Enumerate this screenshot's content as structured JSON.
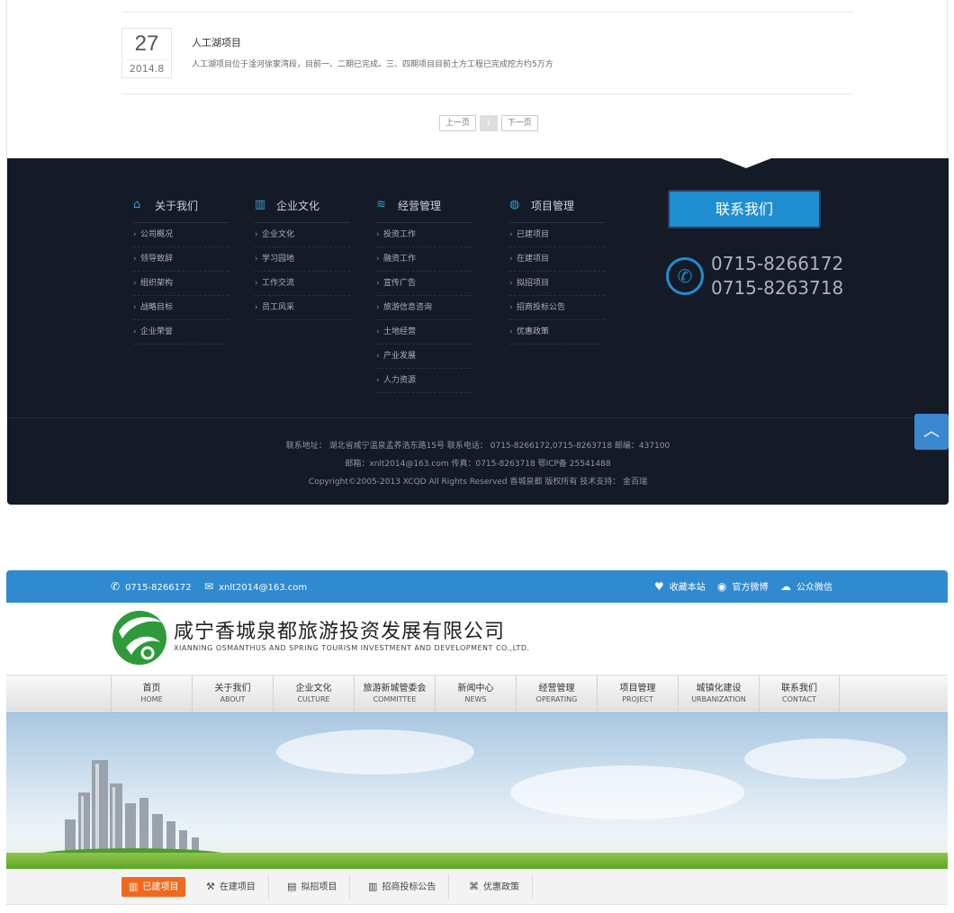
{
  "news": {
    "day": "27",
    "ym": "2014.8",
    "title": "人工湖项目",
    "desc": "人工湖项目位于淦河徐家湾段，目前一、二期已完成。三、四期项目目前土方工程已完成挖方约5万方"
  },
  "pager": {
    "prev": "上一页",
    "current": "1",
    "next": "下一页"
  },
  "footer": {
    "columns": [
      {
        "title": "关于我们",
        "icon": "home-icon",
        "items": [
          "公司概况",
          "领导致辞",
          "组织架构",
          "战略目标",
          "企业荣誉"
        ]
      },
      {
        "title": "企业文化",
        "icon": "building-icon",
        "items": [
          "企业文化",
          "学习园地",
          "工作交流",
          "员工风采"
        ]
      },
      {
        "title": "经营管理",
        "icon": "layers-icon",
        "items": [
          "投资工作",
          "融资工作",
          "宣传广告",
          "旅游信息咨询",
          "土地经营",
          "产业发展",
          "人力资源"
        ]
      },
      {
        "title": "项目管理",
        "icon": "globe-icon",
        "items": [
          "已建项目",
          "在建项目",
          "拟招项目",
          "招商投标公告",
          "优惠政策"
        ]
      }
    ],
    "contact_label": "联系我们",
    "phone1": "0715-8266172",
    "phone2": "0715-8263718",
    "info_line1": "联系地址： 湖北省咸宁温泉孟养浩东路15号   联系电话： 0715-8266172,0715-8263718   邮编：437100",
    "info_line2": "邮箱：xnlt2014@163.com   传真：0715-8263718   鄂ICP备 25541488",
    "info_line3": "Copyright©2005-2013 XCQD All Rights Reserved 香城泉都 版权所有  技术支持： 金百瑞"
  },
  "topbar": {
    "phone": "0715-8266172",
    "email": "xnlt2014@163.com",
    "favorite": "收藏本站",
    "weibo": "官方微博",
    "wechat": "公众微信"
  },
  "logo": {
    "cn": "咸宁香城泉都旅游投资发展有限公司",
    "en": "XIANNING OSMANTHUS AND SPRING TOURISM INVESTMENT AND DEVELOPMENT CO.,LTD."
  },
  "nav": [
    {
      "cn": "首页",
      "en": "HOME"
    },
    {
      "cn": "关于我们",
      "en": "ABOUT"
    },
    {
      "cn": "企业文化",
      "en": "CULTURE"
    },
    {
      "cn": "旅游新城管委会",
      "en": "COMMITTEE"
    },
    {
      "cn": "新闻中心",
      "en": "NEWS"
    },
    {
      "cn": "经营管理",
      "en": "OPERATING"
    },
    {
      "cn": "项目管理",
      "en": "PROJECT"
    },
    {
      "cn": "城镇化建设",
      "en": "URBANIZATION"
    },
    {
      "cn": "联系我们",
      "en": "CONTACT"
    }
  ],
  "subnav": [
    "已建项目",
    "在建项目",
    "拟招项目",
    "招商投标公告",
    "优惠政策"
  ],
  "colors": {
    "accent": "#2f8ad0",
    "footer_bg": "#141a26",
    "active_tab": "#f06a1e",
    "logo_green": "#2e9a3a"
  }
}
